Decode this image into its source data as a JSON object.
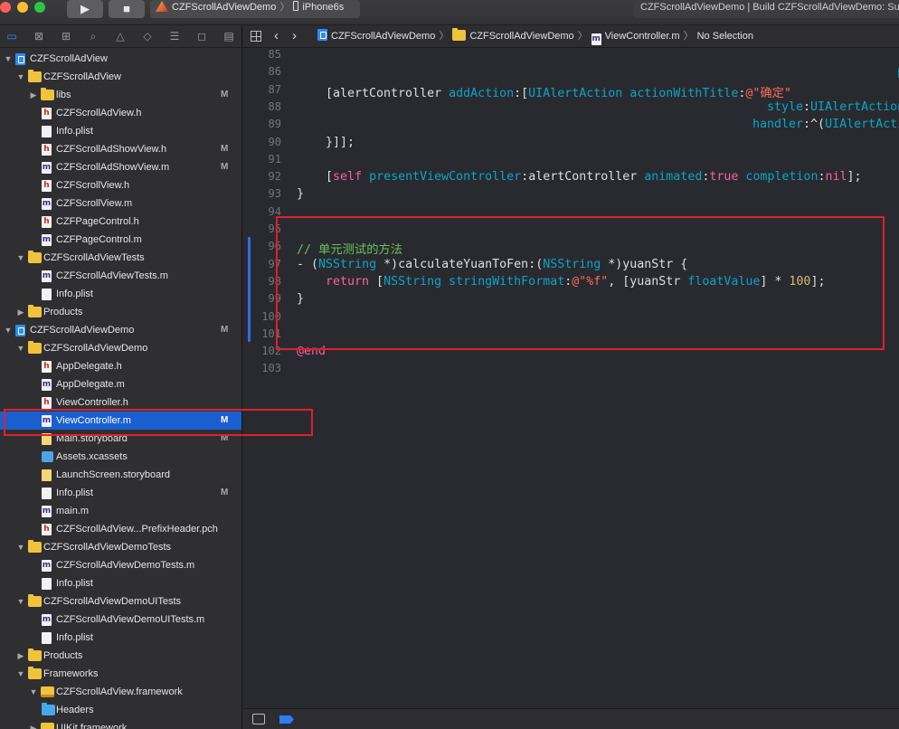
{
  "toolbar": {
    "scheme": "CZFScrollAdViewDemo",
    "device": "iPhone6s",
    "activity": "CZFScrollAdViewDemo | Build CZFScrollAdViewDemo: Succeeded"
  },
  "navigator": {
    "tabs": [
      "folder-icon",
      "x-square-icon",
      "hierarchy-icon",
      "search-icon",
      "warning-icon",
      "diamond-icon",
      "list-icon",
      "tag-icon",
      "comment-icon"
    ],
    "rows": [
      {
        "label": "CZFScrollAdView",
        "icon": "project-icon",
        "level": 0,
        "disclosure": "open",
        "badge": ""
      },
      {
        "label": "CZFScrollAdView",
        "icon": "folder-icon",
        "level": 1,
        "disclosure": "open",
        "badge": ""
      },
      {
        "label": "libs",
        "icon": "folder-icon",
        "level": 2,
        "disclosure": "closed",
        "badge": "M"
      },
      {
        "label": "CZFScrollAdView.h",
        "icon": "header-file-icon",
        "level": 3,
        "disclosure": "",
        "badge": ""
      },
      {
        "label": "Info.plist",
        "icon": "plist-file-icon",
        "level": 3,
        "disclosure": "",
        "badge": ""
      },
      {
        "label": "CZFScrollAdShowView.h",
        "icon": "header-file-icon",
        "level": 3,
        "disclosure": "",
        "badge": "M"
      },
      {
        "label": "CZFScrollAdShowView.m",
        "icon": "m-file-icon",
        "level": 3,
        "disclosure": "",
        "badge": "M"
      },
      {
        "label": "CZFScrollView.h",
        "icon": "header-file-icon",
        "level": 3,
        "disclosure": "",
        "badge": ""
      },
      {
        "label": "CZFScrollView.m",
        "icon": "m-file-icon",
        "level": 3,
        "disclosure": "",
        "badge": ""
      },
      {
        "label": "CZFPageControl.h",
        "icon": "header-file-icon",
        "level": 3,
        "disclosure": "",
        "badge": ""
      },
      {
        "label": "CZFPageControl.m",
        "icon": "m-file-icon",
        "level": 3,
        "disclosure": "",
        "badge": ""
      },
      {
        "label": "CZFScrollAdViewTests",
        "icon": "folder-icon",
        "level": 1,
        "disclosure": "open",
        "badge": ""
      },
      {
        "label": "CZFScrollAdViewTests.m",
        "icon": "m-file-icon",
        "level": 3,
        "disclosure": "",
        "badge": ""
      },
      {
        "label": "Info.plist",
        "icon": "plist-file-icon",
        "level": 3,
        "disclosure": "",
        "badge": ""
      },
      {
        "label": "Products",
        "icon": "folder-icon",
        "level": 1,
        "disclosure": "closed",
        "badge": ""
      },
      {
        "label": "CZFScrollAdViewDemo",
        "icon": "project-icon",
        "level": 0,
        "disclosure": "open",
        "badge": "M"
      },
      {
        "label": "CZFScrollAdViewDemo",
        "icon": "folder-icon",
        "level": 1,
        "disclosure": "open",
        "badge": ""
      },
      {
        "label": "AppDelegate.h",
        "icon": "header-file-icon",
        "level": 3,
        "disclosure": "",
        "badge": ""
      },
      {
        "label": "AppDelegate.m",
        "icon": "m-file-icon",
        "level": 3,
        "disclosure": "",
        "badge": ""
      },
      {
        "label": "ViewController.h",
        "icon": "header-file-icon",
        "level": 3,
        "disclosure": "",
        "badge": ""
      },
      {
        "label": "ViewController.m",
        "icon": "m-file-icon",
        "level": 3,
        "disclosure": "",
        "badge": "M",
        "selected": true
      },
      {
        "label": "Main.storyboard",
        "icon": "storyboard-file-icon",
        "level": 3,
        "disclosure": "",
        "badge": "M"
      },
      {
        "label": "Assets.xcassets",
        "icon": "assets-icon",
        "level": 3,
        "disclosure": "",
        "badge": ""
      },
      {
        "label": "LaunchScreen.storyboard",
        "icon": "storyboard-file-icon",
        "level": 3,
        "disclosure": "",
        "badge": ""
      },
      {
        "label": "Info.plist",
        "icon": "plist-file-icon",
        "level": 3,
        "disclosure": "",
        "badge": "M"
      },
      {
        "label": "main.m",
        "icon": "m-file-icon",
        "level": 3,
        "disclosure": "",
        "badge": ""
      },
      {
        "label": "CZFScrollAdView...PrefixHeader.pch",
        "icon": "pch-file-icon",
        "level": 3,
        "disclosure": "",
        "badge": ""
      },
      {
        "label": "CZFScrollAdViewDemoTests",
        "icon": "folder-icon",
        "level": 1,
        "disclosure": "open",
        "badge": ""
      },
      {
        "label": "CZFScrollAdViewDemoTests.m",
        "icon": "m-file-icon",
        "level": 3,
        "disclosure": "",
        "badge": ""
      },
      {
        "label": "Info.plist",
        "icon": "plist-file-icon",
        "level": 3,
        "disclosure": "",
        "badge": ""
      },
      {
        "label": "CZFScrollAdViewDemoUITests",
        "icon": "folder-icon",
        "level": 1,
        "disclosure": "open",
        "badge": ""
      },
      {
        "label": "CZFScrollAdViewDemoUITests.m",
        "icon": "m-file-icon",
        "level": 3,
        "disclosure": "",
        "badge": ""
      },
      {
        "label": "Info.plist",
        "icon": "plist-file-icon",
        "level": 3,
        "disclosure": "",
        "badge": ""
      },
      {
        "label": "Products",
        "icon": "folder-icon",
        "level": 1,
        "disclosure": "closed",
        "badge": ""
      },
      {
        "label": "Frameworks",
        "icon": "folder-icon",
        "level": 1,
        "disclosure": "open",
        "badge": ""
      },
      {
        "label": "CZFScrollAdView.framework",
        "icon": "framework-icon",
        "level": 2,
        "disclosure": "open",
        "badge": ""
      },
      {
        "label": "Headers",
        "icon": "blue-folder-icon",
        "level": 3,
        "disclosure": "closed",
        "badge": ""
      },
      {
        "label": "UIKit.framework",
        "icon": "framework-icon",
        "level": 2,
        "disclosure": "closed",
        "badge": ""
      }
    ]
  },
  "jumpbar": {
    "crumbs": [
      {
        "label": "CZFScrollAdViewDemo",
        "icon": "project-icon"
      },
      {
        "label": "CZFScrollAdViewDemo",
        "icon": "folder-icon"
      },
      {
        "label": "ViewController.m",
        "icon": "m-file-icon"
      },
      {
        "label": "No Selection",
        "icon": ""
      }
    ]
  },
  "editor": {
    "lines": [
      {
        "num": "85",
        "indent": 0,
        "tokens": []
      },
      {
        "num": "86",
        "indent": 83,
        "tokens": [
          [
            "t",
            "preferr"
          ]
        ]
      },
      {
        "num": "87",
        "indent": 4,
        "tokens": [
          [
            "p",
            "[alertController "
          ],
          [
            "t",
            "addAction"
          ],
          [
            "p",
            ":["
          ],
          [
            "t",
            "UIAlertAction"
          ],
          [
            "p",
            " "
          ],
          [
            "t",
            "actionWithTitle"
          ],
          [
            "p",
            ":"
          ],
          [
            "s",
            "@\"确定\""
          ]
        ]
      },
      {
        "num": "88",
        "indent": 65,
        "tokens": [
          [
            "t",
            "style"
          ],
          [
            "p",
            ":"
          ],
          [
            "t",
            "UIAlertActionSt"
          ]
        ]
      },
      {
        "num": "89",
        "indent": 63,
        "tokens": [
          [
            "t",
            "handler"
          ],
          [
            "p",
            ":^("
          ],
          [
            "t",
            "UIAlertAction"
          ]
        ]
      },
      {
        "num": "90",
        "indent": 4,
        "tokens": [
          [
            "p",
            "}]];"
          ]
        ]
      },
      {
        "num": "91",
        "indent": 0,
        "tokens": []
      },
      {
        "num": "92",
        "indent": 4,
        "tokens": [
          [
            "p",
            "["
          ],
          [
            "k",
            "self"
          ],
          [
            "p",
            " "
          ],
          [
            "t",
            "presentViewController"
          ],
          [
            "p",
            ":alertController "
          ],
          [
            "t",
            "animated"
          ],
          [
            "p",
            ":"
          ],
          [
            "k",
            "true"
          ],
          [
            "p",
            " "
          ],
          [
            "t",
            "completion"
          ],
          [
            "p",
            ":"
          ],
          [
            "k",
            "nil"
          ],
          [
            "p",
            "];"
          ]
        ]
      },
      {
        "num": "93",
        "indent": 0,
        "tokens": [
          [
            "p",
            "}"
          ]
        ]
      },
      {
        "num": "94",
        "indent": 0,
        "tokens": []
      },
      {
        "num": "95",
        "indent": 0,
        "tokens": []
      },
      {
        "num": "96",
        "indent": 0,
        "tokens": [
          [
            "c",
            "// 单元测试的方法"
          ]
        ]
      },
      {
        "num": "97",
        "indent": 0,
        "tokens": [
          [
            "p",
            "- ("
          ],
          [
            "t",
            "NSString"
          ],
          [
            "p",
            " *)calculateYuanToFen:("
          ],
          [
            "t",
            "NSString"
          ],
          [
            "p",
            " *)yuanStr {"
          ]
        ]
      },
      {
        "num": "98",
        "indent": 4,
        "tokens": [
          [
            "k",
            "return"
          ],
          [
            "p",
            " ["
          ],
          [
            "t",
            "NSString"
          ],
          [
            "p",
            " "
          ],
          [
            "t",
            "stringWithFormat"
          ],
          [
            "p",
            ":"
          ],
          [
            "s",
            "@\"%f\""
          ],
          [
            "p",
            ", [yuanStr "
          ],
          [
            "t",
            "floatValue"
          ],
          [
            "p",
            "] * "
          ],
          [
            "n",
            "100"
          ],
          [
            "p",
            "];"
          ]
        ]
      },
      {
        "num": "99",
        "indent": 0,
        "tokens": [
          [
            "p",
            "}"
          ]
        ]
      },
      {
        "num": "100",
        "indent": 0,
        "tokens": []
      },
      {
        "num": "101",
        "indent": 0,
        "tokens": []
      },
      {
        "num": "102",
        "indent": 0,
        "tokens": [
          [
            "k",
            "@end"
          ]
        ]
      },
      {
        "num": "103",
        "indent": 0,
        "tokens": []
      }
    ]
  },
  "colors": {
    "selection": "#1a5fd0",
    "annotation": "#e0202a",
    "keyword": "#fc5fa3",
    "string": "#fc6a5d",
    "number": "#d0bf69",
    "comment": "#6bbf59",
    "identifier": "#0ba5c4"
  }
}
